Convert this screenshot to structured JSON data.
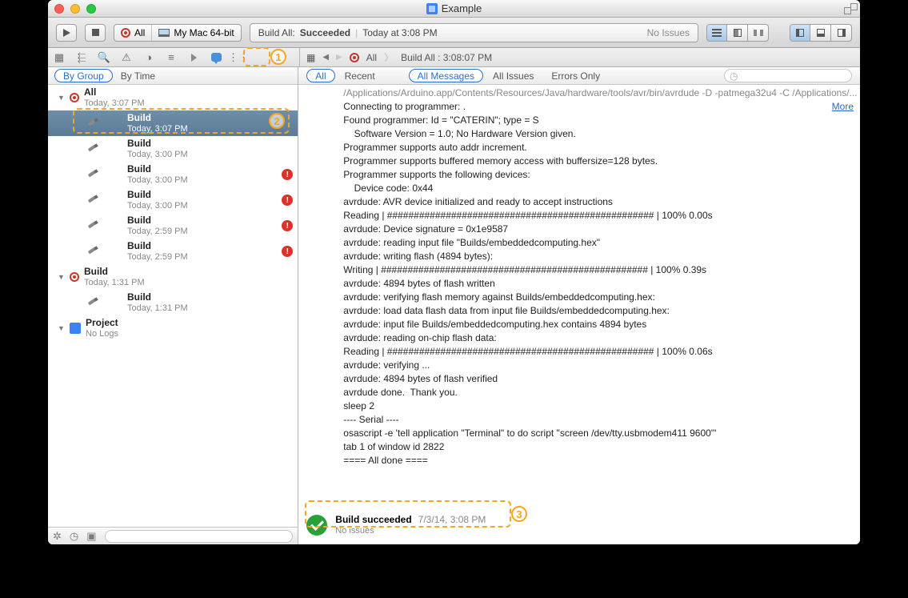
{
  "window": {
    "title": "Example"
  },
  "toolbar": {
    "scheme": {
      "name": "All",
      "device": "My Mac 64-bit"
    },
    "activity": {
      "line1a": "Build All:",
      "line1b": "Succeeded",
      "line2": "Today at 3:08 PM",
      "right": "No Issues"
    }
  },
  "jumpbar": {
    "scheme": "All",
    "target": "Build All : 3:08:07 PM"
  },
  "sidebar": {
    "filters": {
      "by_group": "By Group",
      "by_time": "By Time"
    },
    "tree": [
      {
        "kind": "scheme",
        "title": "All",
        "sub": "Today, 3:07 PM"
      },
      {
        "kind": "build",
        "title": "Build",
        "sub": "Today, 3:07 PM",
        "selected": true
      },
      {
        "kind": "build",
        "title": "Build",
        "sub": "Today, 3:00 PM"
      },
      {
        "kind": "build",
        "title": "Build",
        "sub": "Today, 3:00 PM",
        "error": true
      },
      {
        "kind": "build",
        "title": "Build",
        "sub": "Today, 3:00 PM",
        "error": true
      },
      {
        "kind": "build",
        "title": "Build",
        "sub": "Today, 2:59 PM",
        "error": true
      },
      {
        "kind": "build",
        "title": "Build",
        "sub": "Today, 2:59 PM",
        "error": true
      },
      {
        "kind": "scheme",
        "title": "Build",
        "sub": "Today, 1:31 PM"
      },
      {
        "kind": "build",
        "title": "Build",
        "sub": "Today, 1:31 PM"
      },
      {
        "kind": "project",
        "title": "Project",
        "sub": "No Logs"
      }
    ]
  },
  "scope": {
    "all": "All",
    "recent": "Recent",
    "all_messages": "All Messages",
    "all_issues": "All Issues",
    "errors_only": "Errors Only"
  },
  "log": {
    "truncated_prefix": "/Applications/Arduino.app/Contents/Resources/Java/hardware/tools/avr/bin/avrdude -D -patmega32u4 -C /Applications/...",
    "more": "More",
    "lines": [
      "Connecting to programmer: .",
      "Found programmer: Id = \"CATERIN\"; type = S",
      "    Software Version = 1.0; No Hardware Version given.",
      "Programmer supports auto addr increment.",
      "Programmer supports buffered memory access with buffersize=128 bytes.",
      "Programmer supports the following devices:",
      "    Device code: 0x44",
      "avrdude: AVR device initialized and ready to accept instructions",
      "Reading | ################################################## | 100% 0.00s",
      "avrdude: Device signature = 0x1e9587",
      "avrdude: reading input file \"Builds/embeddedcomputing.hex\"",
      "avrdude: writing flash (4894 bytes):",
      "Writing | ################################################## | 100% 0.39s",
      "avrdude: 4894 bytes of flash written",
      "avrdude: verifying flash memory against Builds/embeddedcomputing.hex:",
      "avrdude: load data flash data from input file Builds/embeddedcomputing.hex:",
      "avrdude: input file Builds/embeddedcomputing.hex contains 4894 bytes",
      "avrdude: reading on-chip flash data:",
      "Reading | ################################################## | 100% 0.06s",
      "avrdude: verifying ...",
      "avrdude: 4894 bytes of flash verified",
      "avrdude done.  Thank you.",
      "sleep 2",
      "---- Serial ----",
      "osascript -e 'tell application \"Terminal\" to do script \"screen /dev/tty.usbmodem411 9600\"'",
      "tab 1 of window id 2822",
      "==== All done ===="
    ]
  },
  "status": {
    "title": "Build succeeded",
    "time": "7/3/14, 3:08 PM",
    "sub": "No issues"
  },
  "callouts": {
    "c1": "1",
    "c2": "2",
    "c3": "3"
  }
}
